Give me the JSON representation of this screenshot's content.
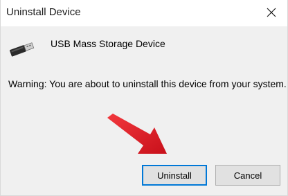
{
  "dialog": {
    "title": "Uninstall Device",
    "device_name": "USB Mass Storage Device",
    "warning": "Warning: You are about to uninstall this device from your system.",
    "device_icon": "usb-device-icon",
    "close_icon": "close-icon"
  },
  "buttons": {
    "uninstall_label": "Uninstall",
    "cancel_label": "Cancel"
  },
  "annotation": {
    "arrow_color": "#e8141b"
  }
}
